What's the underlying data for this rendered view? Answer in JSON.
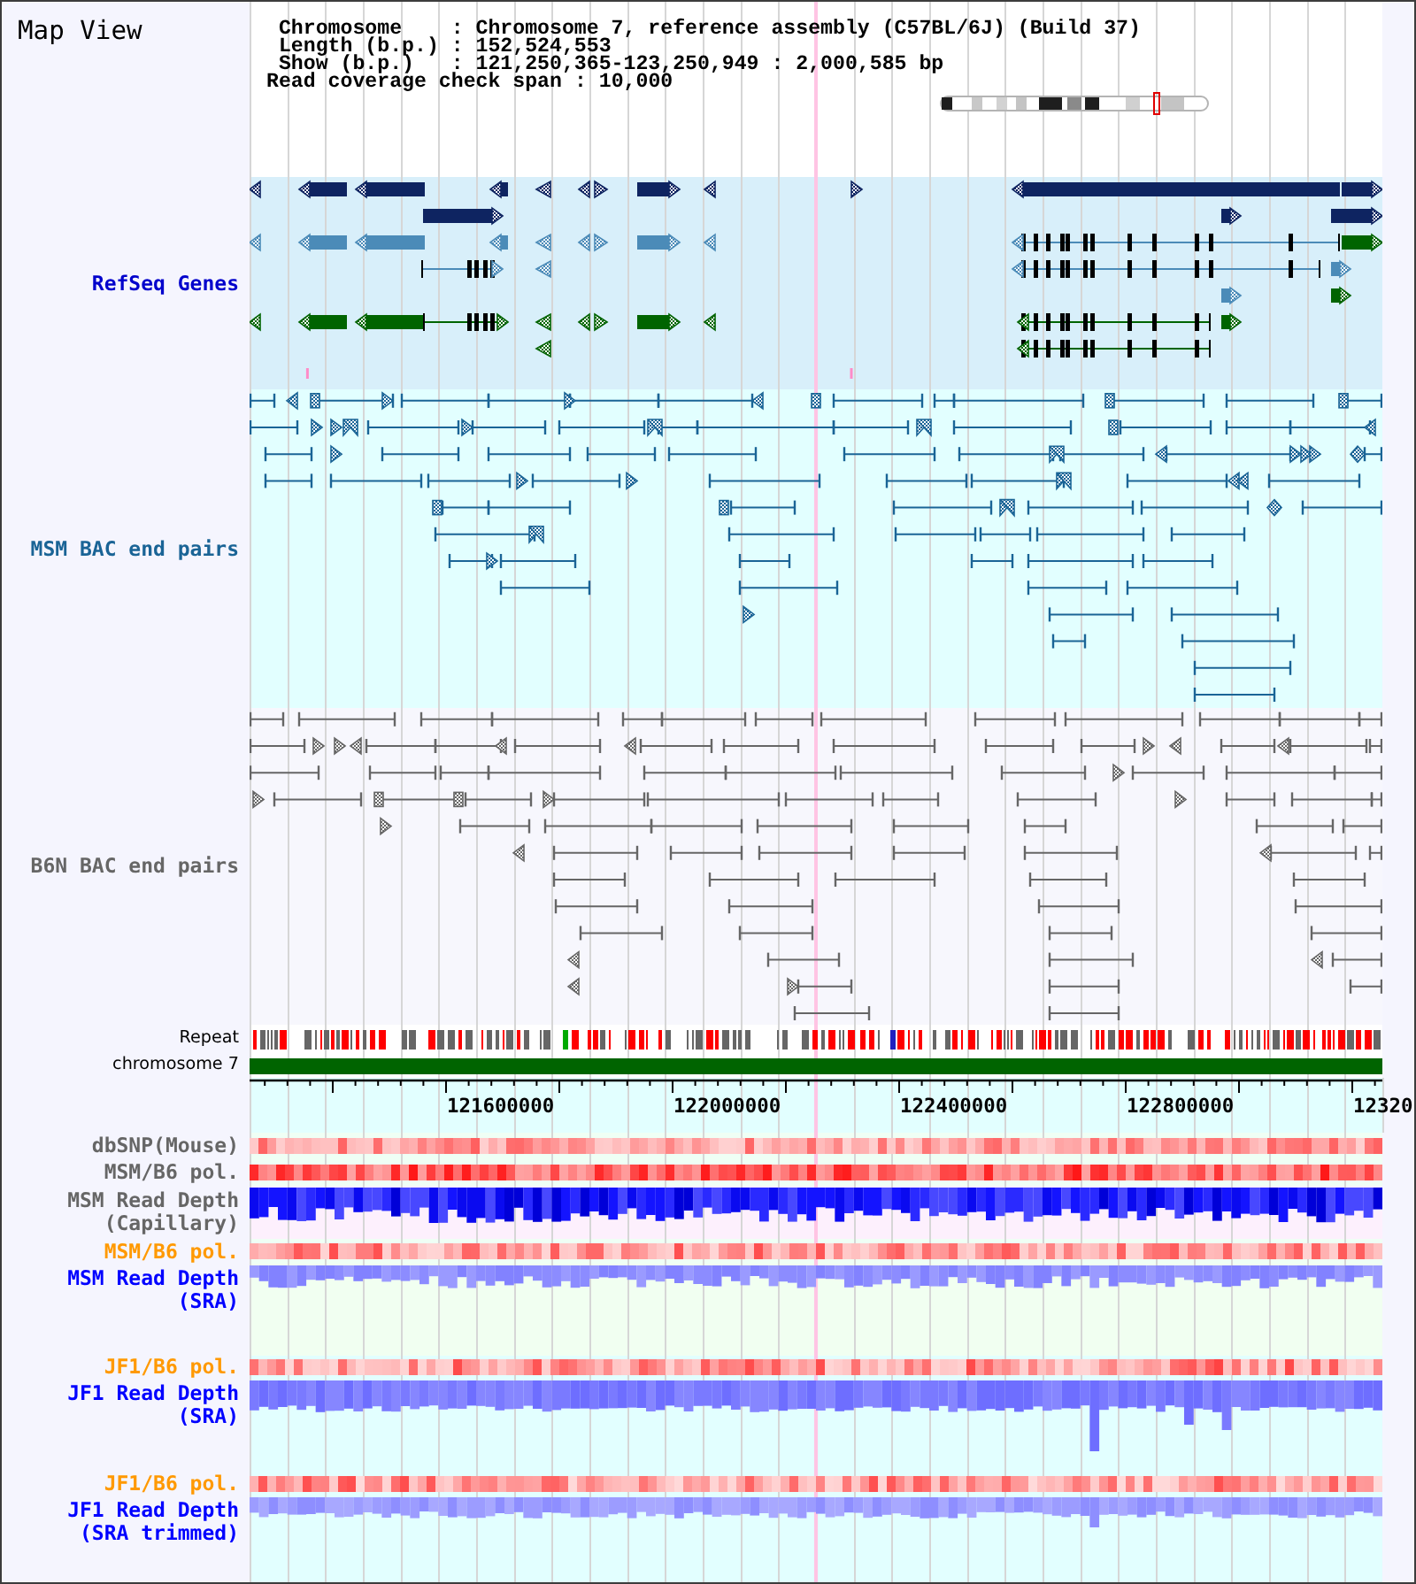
{
  "panel_title": "Map View",
  "summary": {
    "rows": [
      {
        "label": "Chromosome",
        "sep": ":",
        "value": "Chromosome 7, reference assembly (C57BL/6J) (Build 37)"
      },
      {
        "label": "Length (b.p.)",
        "sep": ":",
        "value": "152,524,553"
      },
      {
        "label": "Show (b.p.)",
        "sep": ":",
        "value": "121,250,365-123,250,949 : 2,000,585 bp"
      }
    ],
    "coverage": {
      "label": "Read coverage check span",
      "sep": ":",
      "value": "10,000"
    }
  },
  "tracks": [
    {
      "kind": "genes",
      "label": "RefSeq Genes",
      "color": "#0000cc"
    },
    {
      "kind": "bac_pairs",
      "label": "MSM BAC end pairs",
      "color": "#1a6496"
    },
    {
      "kind": "bac_pairs",
      "label": "B6N BAC end pairs",
      "color": "#666666"
    },
    {
      "kind": "repeat",
      "label": "Repeat"
    },
    {
      "kind": "chromosome",
      "label": "chromosome 7"
    },
    {
      "kind": "ruler",
      "tick_labels": [
        "121600000",
        "122000000",
        "122400000",
        "122800000",
        "12320"
      ]
    },
    {
      "kind": "heatmap",
      "label": "dbSNP(Mouse)",
      "color": "#666666"
    },
    {
      "kind": "heatmap",
      "label": "MSM/B6 pol.",
      "color": "#666666"
    },
    {
      "kind": "depth",
      "label": "MSM Read Depth (Capillary)",
      "color": "#666666"
    },
    {
      "kind": "heatmap",
      "label": "MSM/B6 pol.",
      "color": "#ff9900"
    },
    {
      "kind": "depth",
      "label": "MSM Read Depth (SRA)",
      "color": "#0000ff"
    },
    {
      "kind": "heatmap",
      "label": "JF1/B6 pol.",
      "color": "#ff9900"
    },
    {
      "kind": "depth",
      "label": "JF1 Read Depth (SRA)",
      "color": "#0000ff"
    },
    {
      "kind": "heatmap",
      "label": "JF1/B6 pol.",
      "color": "#ff9900"
    },
    {
      "kind": "depth",
      "label": "JF1 Read Depth (SRA trimmed)",
      "color": "#0000ff"
    }
  ]
}
